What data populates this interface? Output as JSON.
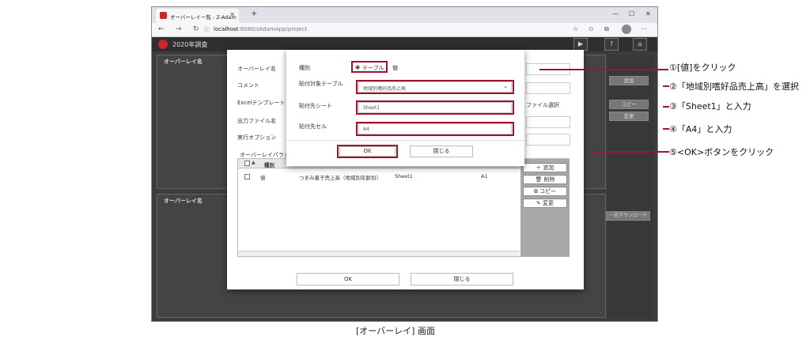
{
  "browser": {
    "tab_title": "オーバーレイ一覧 - Z-Adam",
    "tab_close": "✕",
    "new_tab": "+",
    "url_host": "localhost",
    "url_rest": ":8080/zAdamApp/project"
  },
  "app": {
    "title": "2020年調査",
    "panel1_label": "オーバーレイ名",
    "panel2_label": "オーバーレイ名",
    "bg_add": "追加",
    "bg_copy": "コピー",
    "bg_change": "変更",
    "bg_download": "一括ダウンロード"
  },
  "dialog": {
    "overlay_name_label": "オーバーレイ名",
    "comment_label": "コメント",
    "excel_template_label": "Excelテンプレート",
    "output_file_label": "出力ファイル名",
    "exec_option_label": "実行オプション",
    "params_label": "オーバーレイパラメ",
    "file_select_label": "ファイル選択",
    "grid": {
      "col_type": "種別",
      "row": {
        "type": "値",
        "table": "つまみ菓子売上高（地域別年齢別）",
        "sheet": "Sheet1",
        "cell": "A1"
      }
    },
    "add": "追加",
    "delete": "削除",
    "copy": "コピー",
    "change": "変更",
    "ok": "OK",
    "close": "閉じる"
  },
  "subdialog": {
    "type_label": "種別",
    "type_table": "テーブル",
    "type_value": "値",
    "paste_table_label": "貼付対象テーブル",
    "paste_table_value": "地域別嗜好品売上高",
    "sheet_label": "貼付先シート",
    "sheet_value": "Sheet1",
    "cell_label": "貼付先セル",
    "cell_value": "A4",
    "ok": "OK",
    "close": "閉じる"
  },
  "callouts": [
    "①[値]をクリック",
    "②「地域別嗜好品売上高」を選択",
    "③「Sheet1」と入力",
    "④「A4」と入力",
    "⑤<OK>ボタンをクリック"
  ],
  "caption": "[オーバーレイ] 画面",
  "colors": {
    "accent": "#a1122e",
    "brand": "#c62828"
  }
}
